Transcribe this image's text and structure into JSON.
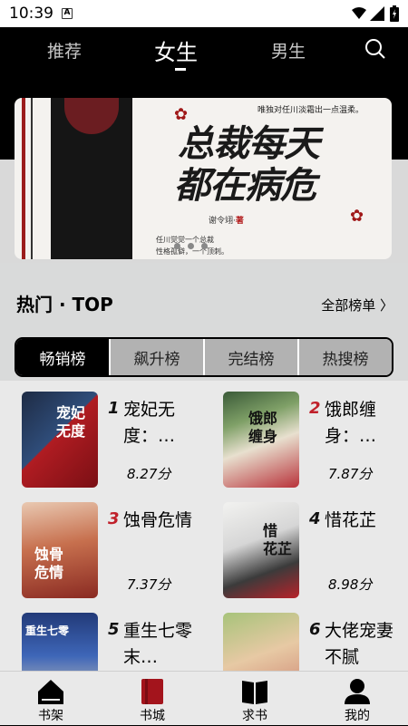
{
  "status": {
    "time": "10:39"
  },
  "header": {
    "tabs": [
      "推荐",
      "女生",
      "男生"
    ],
    "active_tab": "女生"
  },
  "banner": {
    "title_line1": "总裁每天",
    "title_line2": "都在病危",
    "topline": "唯独对任川淡霜出一点温柔。",
    "author_prefix": "谢令翊·",
    "author_mark": "著",
    "line1": "任川觉觉一个总裁",
    "line2": "性格孤僻，一个顶刺。"
  },
  "section": {
    "title": "热门 · TOP",
    "more": "全部榜单 〉"
  },
  "rank_tabs": [
    "畅销榜",
    "飙升榜",
    "完结榜",
    "热搜榜"
  ],
  "books": [
    {
      "rank": "1",
      "title": "宠妃无度：…",
      "score": "8.27分",
      "cover_text": "宠妃\n无度"
    },
    {
      "rank": "2",
      "title": "饿郎缠身：…",
      "score": "7.87分",
      "cover_text": "饿郎\n缠身"
    },
    {
      "rank": "3",
      "title": "蚀骨危情",
      "score": "7.37分",
      "cover_text": "蚀骨\n危情"
    },
    {
      "rank": "4",
      "title": "惜花芷",
      "score": "8.98分",
      "cover_text": "惜\n花芷"
    },
    {
      "rank": "5",
      "title": "重生七零末…",
      "score": "",
      "cover_text": "重生七零"
    },
    {
      "rank": "6",
      "title": "大佬宠妻不腻",
      "score": "",
      "cover_text": ""
    }
  ],
  "nav": [
    "书架",
    "书城",
    "求书",
    "我的"
  ],
  "colors": {
    "accent": "#c0202a",
    "dark": "#000000"
  }
}
